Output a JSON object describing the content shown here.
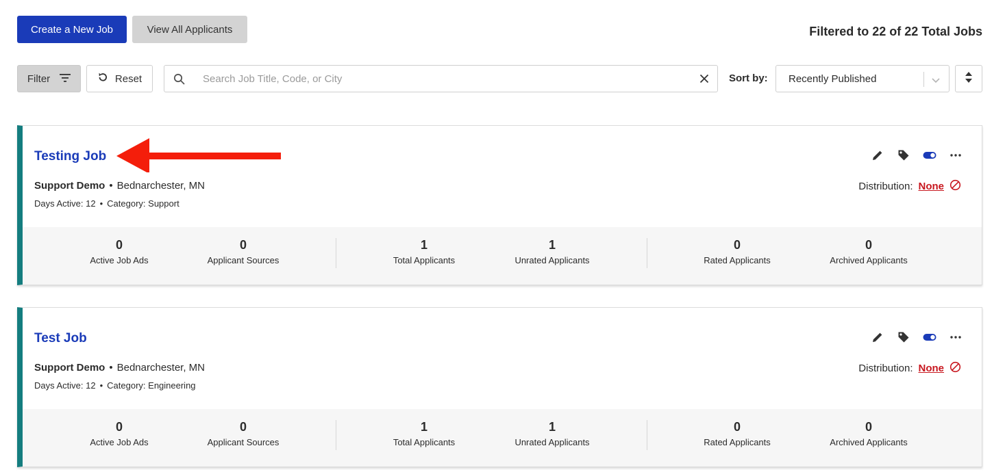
{
  "toolbar": {
    "create_label": "Create a New Job",
    "view_all_label": "View All Applicants",
    "total_text": "Filtered to 22 of 22 Total Jobs",
    "filter_label": "Filter",
    "reset_label": "Reset",
    "search_placeholder": "Search Job Title, Code, or City",
    "sort_label": "Sort by:",
    "sort_value": "Recently Published"
  },
  "colors": {
    "primary": "#1a3bb8",
    "accent_border": "#147d7f",
    "danger": "#c8171f",
    "annotation_arrow": "#f41e0b"
  },
  "jobs": [
    {
      "title": "Testing Job",
      "company": "Support Demo",
      "location": "Bednarchester, MN",
      "days_active": "Days Active: 12",
      "category": "Category: Support",
      "distribution_label": "Distribution:",
      "distribution_value": "None",
      "stats": [
        {
          "value": "0",
          "label": "Active Job Ads"
        },
        {
          "value": "0",
          "label": "Applicant Sources"
        },
        {
          "value": "1",
          "label": "Total Applicants"
        },
        {
          "value": "1",
          "label": "Unrated Applicants"
        },
        {
          "value": "0",
          "label": "Rated Applicants"
        },
        {
          "value": "0",
          "label": "Archived Applicants"
        }
      ]
    },
    {
      "title": "Test Job",
      "company": "Support Demo",
      "location": "Bednarchester, MN",
      "days_active": "Days Active: 12",
      "category": "Category: Engineering",
      "distribution_label": "Distribution:",
      "distribution_value": "None",
      "stats": [
        {
          "value": "0",
          "label": "Active Job Ads"
        },
        {
          "value": "0",
          "label": "Applicant Sources"
        },
        {
          "value": "1",
          "label": "Total Applicants"
        },
        {
          "value": "1",
          "label": "Unrated Applicants"
        },
        {
          "value": "0",
          "label": "Rated Applicants"
        },
        {
          "value": "0",
          "label": "Archived Applicants"
        }
      ]
    }
  ],
  "icons": [
    "filter-icon",
    "reset-icon",
    "search-icon",
    "clear-icon",
    "chevron-down-icon",
    "sort-order-icon",
    "edit-icon",
    "tag-icon",
    "toggle-icon",
    "more-icon",
    "none-circle-icon",
    "annotation-arrow"
  ]
}
